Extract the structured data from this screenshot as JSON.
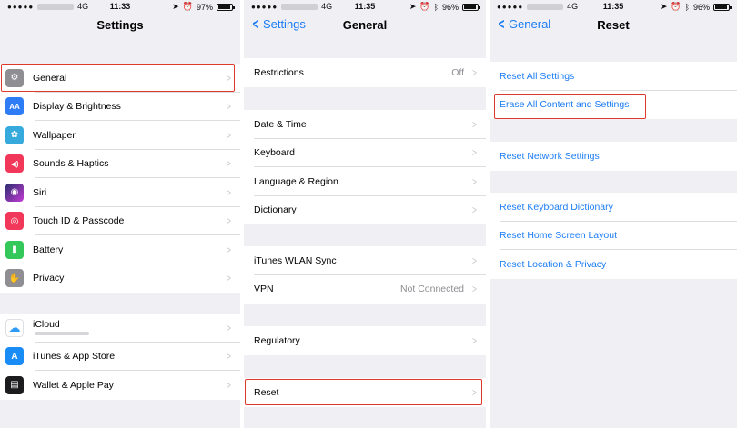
{
  "panels": [
    {
      "status": {
        "carrier": "4G",
        "time": "11:33",
        "battery": "97%"
      },
      "nav": {
        "title": "Settings"
      },
      "groups": [
        [
          {
            "label": "General",
            "icon": "gear-icon",
            "color": "#8e8e93",
            "glyph": "⚙"
          },
          {
            "label": "Display & Brightness",
            "icon": "text-size-icon",
            "color": "#2e7cf6",
            "glyph": "AA"
          },
          {
            "label": "Wallpaper",
            "icon": "flower-icon",
            "color": "#36aadc",
            "glyph": "✿"
          },
          {
            "label": "Sounds & Haptics",
            "icon": "speaker-icon",
            "color": "#f2385a",
            "glyph": "◀)"
          },
          {
            "label": "Siri",
            "icon": "siri-icon",
            "color": "#2b2d6e",
            "glyph": "◉"
          },
          {
            "label": "Touch ID & Passcode",
            "icon": "fingerprint-icon",
            "color": "#f2385a",
            "glyph": "◎"
          },
          {
            "label": "Battery",
            "icon": "battery-icon",
            "color": "#34c759",
            "glyph": "▮"
          },
          {
            "label": "Privacy",
            "icon": "hand-icon",
            "color": "#8e8e93",
            "glyph": "✋"
          }
        ],
        [
          {
            "label": "iCloud",
            "icon": "cloud-icon",
            "color": "#ffffff",
            "glyph": "☁"
          },
          {
            "label": "iTunes & App Store",
            "icon": "app-store-icon",
            "color": "#1a8cf6",
            "glyph": "A"
          },
          {
            "label": "Wallet & Apple Pay",
            "icon": "wallet-icon",
            "color": "#1c1c1e",
            "glyph": "▤"
          }
        ]
      ]
    },
    {
      "status": {
        "carrier": "4G",
        "time": "11:35",
        "battery": "96%"
      },
      "nav": {
        "back": "Settings",
        "title": "General"
      },
      "groups": [
        [
          {
            "label": "Restrictions",
            "value": "Off"
          }
        ],
        [
          {
            "label": "Date & Time"
          },
          {
            "label": "Keyboard"
          },
          {
            "label": "Language & Region"
          },
          {
            "label": "Dictionary"
          }
        ],
        [
          {
            "label": "iTunes WLAN Sync"
          },
          {
            "label": "VPN",
            "value": "Not Connected"
          }
        ],
        [
          {
            "label": "Regulatory"
          }
        ],
        [
          {
            "label": "Reset"
          }
        ]
      ]
    },
    {
      "status": {
        "carrier": "4G",
        "time": "11:35",
        "battery": "96%"
      },
      "nav": {
        "back": "General",
        "title": "Reset"
      },
      "groups": [
        [
          {
            "label": "Reset All Settings"
          },
          {
            "label": "Erase All Content and Settings"
          }
        ],
        [
          {
            "label": "Reset Network Settings"
          }
        ],
        [
          {
            "label": "Reset Keyboard Dictionary"
          },
          {
            "label": "Reset Home Screen Layout"
          },
          {
            "label": "Reset Location & Privacy"
          }
        ]
      ]
    }
  ]
}
